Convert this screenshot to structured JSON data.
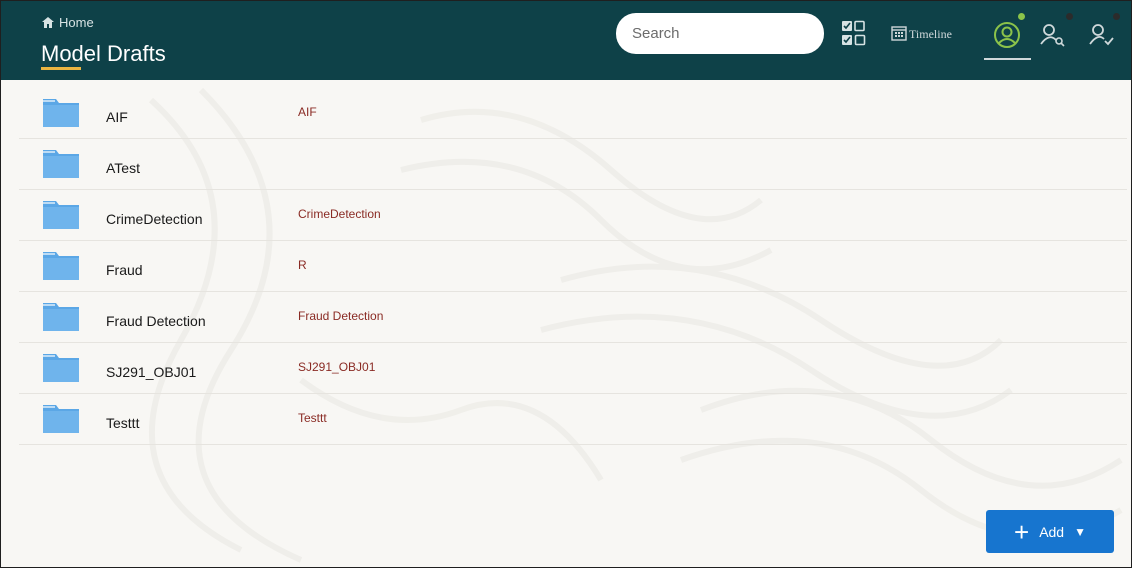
{
  "header": {
    "breadcrumb": "Home",
    "title": "Model Drafts",
    "search_placeholder": "Search",
    "timeline_label": "Timeline",
    "icons": [
      "grid-view-icon",
      "calendar-icon",
      "user-circle-icon",
      "user-search-icon",
      "user-check-icon"
    ]
  },
  "drafts": [
    {
      "name": "AIF",
      "description": "AIF"
    },
    {
      "name": "ATest",
      "description": ""
    },
    {
      "name": "CrimeDetection",
      "description": "CrimeDetection"
    },
    {
      "name": "Fraud",
      "description": "R"
    },
    {
      "name": "Fraud Detection",
      "description": "Fraud Detection"
    },
    {
      "name": "SJ291_OBJ01",
      "description": "SJ291_OBJ01"
    },
    {
      "name": "Testtt",
      "description": "Testtt"
    }
  ],
  "add_button": {
    "label": "Add"
  },
  "colors": {
    "header_bg": "#0e4148",
    "accent_underline": "#e9b441",
    "description_text": "#8a2b24",
    "primary_button": "#1775cf",
    "status_green": "#8bc34a"
  }
}
